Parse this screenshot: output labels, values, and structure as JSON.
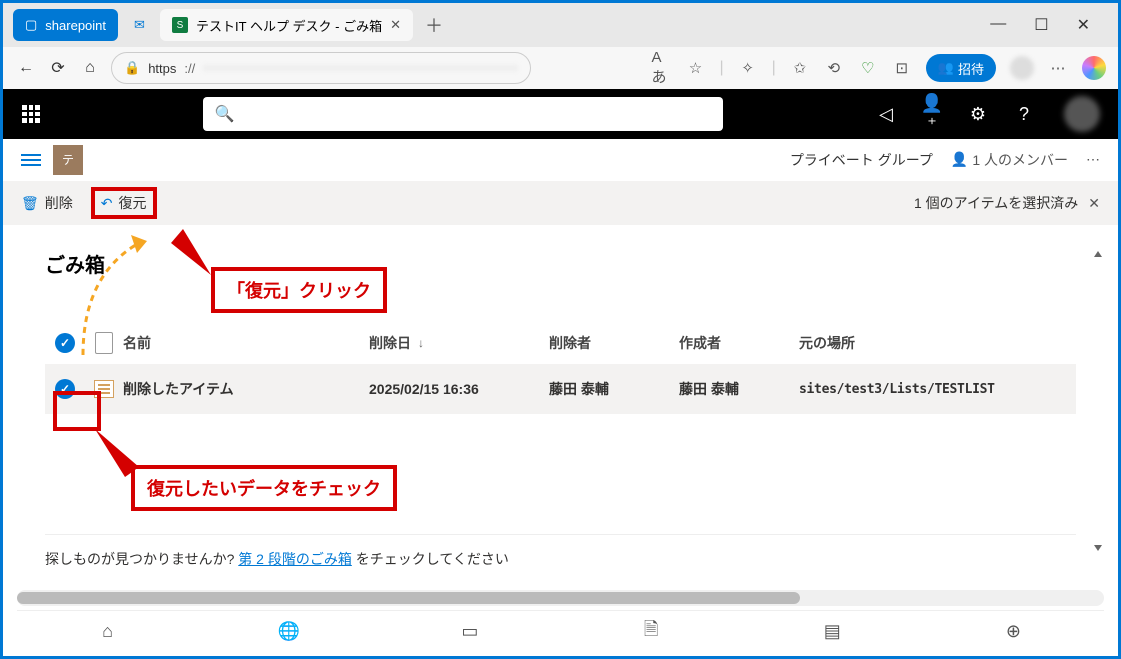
{
  "browser": {
    "tab_sharepoint": "sharepoint",
    "tab_title": "テストIT ヘルプ デスク - ごみ箱",
    "url_scheme": "https",
    "url_text": "://",
    "url_a11y": "Aあ",
    "invite_label": "招待"
  },
  "site": {
    "logo_initial": "テ",
    "group_type": "プライベート グループ",
    "members": "1 人のメンバー"
  },
  "commands": {
    "delete": "削除",
    "restore": "復元",
    "selection": "1 個のアイテムを選択済み"
  },
  "page": {
    "title": "ごみ箱"
  },
  "columns": {
    "name": "名前",
    "deleted_date": "削除日",
    "deleted_by": "削除者",
    "created_by": "作成者",
    "original_location": "元の場所"
  },
  "rows": [
    {
      "name": "削除したアイテム",
      "deleted_date": "2025/02/15 16:36",
      "deleted_by": "藤田 泰輔",
      "created_by": "藤田 泰輔",
      "original_location": "sites/test3/Lists/TESTLIST"
    }
  ],
  "footer": {
    "prefix": "探しものが見つかりませんか?",
    "link": "第 2 段階のごみ箱",
    "suffix": "をチェックしてください"
  },
  "callouts": {
    "restore_click": "「復元」クリック",
    "check_data": "復元したいデータをチェック"
  }
}
